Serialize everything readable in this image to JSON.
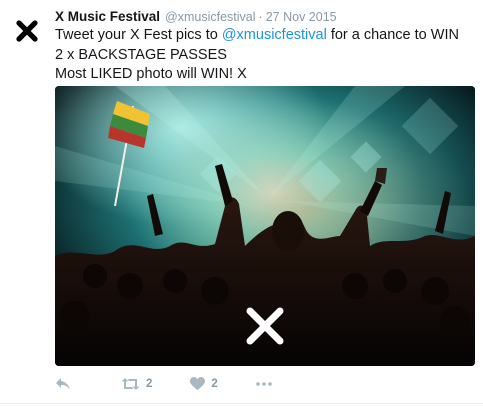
{
  "tweet": {
    "author_name": "X Music Festival",
    "handle": "@xmusicfestival",
    "separator": "·",
    "date": "27 Nov 2015",
    "text_line1_before": "Tweet your X Fest pics to ",
    "mention": "@xmusicfestival",
    "text_line1_after": " for a chance to WIN 2 x BACKSTAGE PASSES",
    "text_line2": "Most LIKED photo will WIN! X"
  },
  "media": {
    "description_icons": [
      "flag-icon",
      "x-logo-watermark"
    ]
  },
  "actions": {
    "reply_icon": "reply-icon",
    "retweet_icon": "retweet-icon",
    "retweet_count": "2",
    "like_icon": "heart-icon",
    "like_count": "2",
    "more_icon": "more-dots-icon"
  },
  "colors": {
    "text": "#14171a",
    "secondary": "#8899a6",
    "link": "#1b95e0",
    "stage_teal": "#49c9c4"
  }
}
